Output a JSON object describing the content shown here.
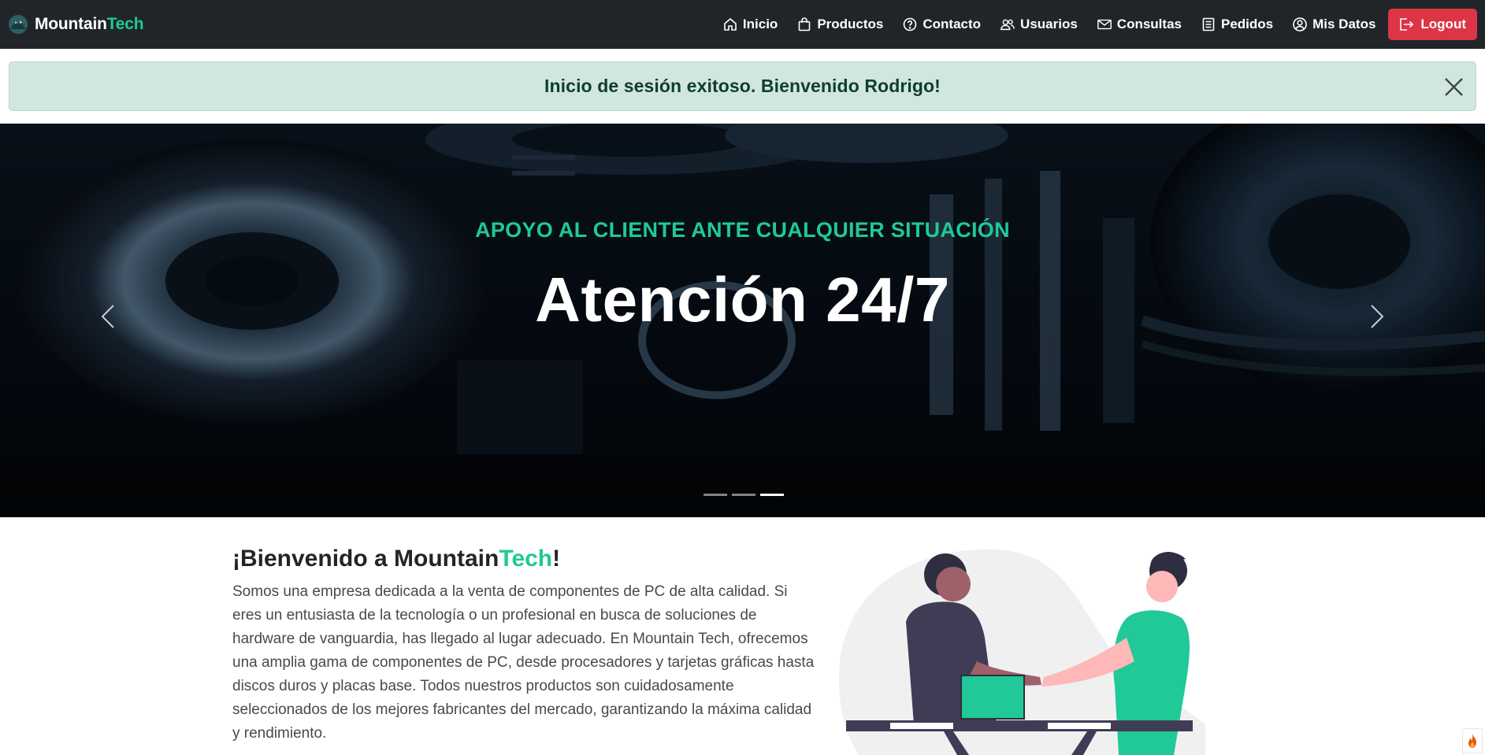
{
  "navbar": {
    "brand_main": "Mountain",
    "brand_accent": "Tech",
    "items": [
      {
        "label": "Inicio",
        "icon": "home-icon"
      },
      {
        "label": "Productos",
        "icon": "bag-icon"
      },
      {
        "label": "Contacto",
        "icon": "question-circle-icon"
      },
      {
        "label": "Usuarios",
        "icon": "users-icon"
      },
      {
        "label": "Consultas",
        "icon": "envelope-icon"
      },
      {
        "label": "Pedidos",
        "icon": "list-document-icon"
      },
      {
        "label": "Mis Datos",
        "icon": "person-circle-icon"
      }
    ],
    "logout_label": "Logout"
  },
  "alert": {
    "message": "Inicio de sesión exitoso. Bienvenido Rodrigo!"
  },
  "carousel": {
    "subtitle": "APOYO AL CLIENTE ANTE CUALQUIER SITUACIÓN",
    "title": "Atención 24/7",
    "slide_count": 3,
    "active_index": 2
  },
  "welcome": {
    "title_prefix": "¡Bienvenido a Mountain",
    "title_accent": "Tech",
    "title_suffix": "!",
    "body": "Somos una empresa dedicada a la venta de componentes de PC de alta calidad. Si eres un entusiasta de la tecnología o un profesional en busca de soluciones de hardware de vanguardia, has llegado al lugar adecuado. En Mountain Tech, ofrecemos una amplia gama de componentes de PC, desde procesadores y tarjetas gráficas hasta discos duros y placas base. Todos nuestros productos son cuidadosamente seleccionados de los mejores fabricantes del mercado, garantizando la máxima calidad y rendimiento."
  },
  "colors": {
    "navbar_bg": "#212529",
    "accent": "#20c997",
    "logout_bg": "#dc3545",
    "alert_bg": "#d1e7dd"
  }
}
